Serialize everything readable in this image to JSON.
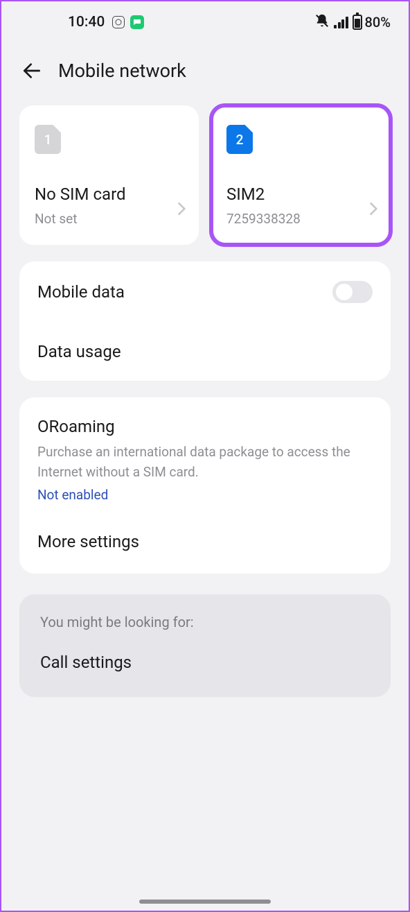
{
  "status_bar": {
    "time": "10:40",
    "battery": "80%"
  },
  "header": {
    "title": "Mobile network"
  },
  "sims": [
    {
      "number": "1",
      "name": "No SIM card",
      "sub": "Not set",
      "active": false
    },
    {
      "number": "2",
      "name": "SIM2",
      "sub": "7259338328",
      "active": true
    }
  ],
  "rows": {
    "mobile_data": "Mobile data",
    "data_usage": "Data usage",
    "oroaming_title": "ORoaming",
    "oroaming_desc": "Purchase an international data package to access the Internet without a SIM card.",
    "oroaming_status": "Not enabled",
    "more_settings": "More settings"
  },
  "suggestion": {
    "label": "You might be looking for:",
    "item": "Call settings"
  }
}
